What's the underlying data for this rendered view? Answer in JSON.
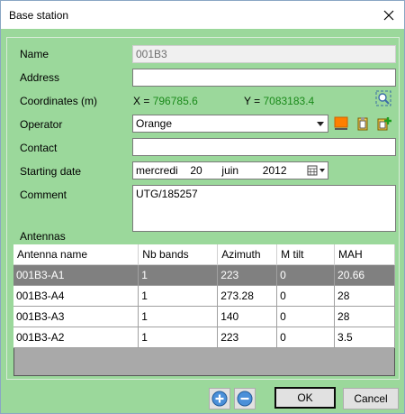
{
  "window": {
    "title": "Base station",
    "close_icon": "close-icon"
  },
  "form": {
    "name": {
      "label": "Name",
      "value": "001B3"
    },
    "address": {
      "label": "Address",
      "value": ""
    },
    "coordinates": {
      "label": "Coordinates (m)",
      "x_label": "X =",
      "x_value": "796785.6",
      "y_label": "Y =",
      "y_value": "7083183.4",
      "locate_icon": "locate-icon"
    },
    "operator": {
      "label": "Operator",
      "value": "Orange",
      "color": "#ff7f00"
    },
    "contact": {
      "label": "Contact",
      "value": ""
    },
    "starting_date": {
      "label": "Starting date",
      "weekday": "mercredi",
      "day": "20",
      "month": "juin",
      "year": "2012"
    },
    "comment": {
      "label": "Comment",
      "value": "UTG/185257"
    }
  },
  "antennas": {
    "label": "Antennas",
    "columns": [
      "Antenna name",
      "Nb bands",
      "Azimuth",
      "M tilt",
      "MAH"
    ],
    "rows": [
      [
        "001B3-A1",
        "1",
        "223",
        "0",
        "20.66"
      ],
      [
        "001B3-A4",
        "1",
        "273.28",
        "0",
        "28"
      ],
      [
        "001B3-A3",
        "1",
        "140",
        "0",
        "28"
      ],
      [
        "001B3-A2",
        "1",
        "223",
        "0",
        "3.5"
      ]
    ],
    "selected_row": 0
  },
  "buttons": {
    "ok": "OK",
    "cancel": "Cancel"
  },
  "colors": {
    "panel": "#9bd89b",
    "coord_value": "#1a8a1a",
    "selected_row": "#808080"
  }
}
